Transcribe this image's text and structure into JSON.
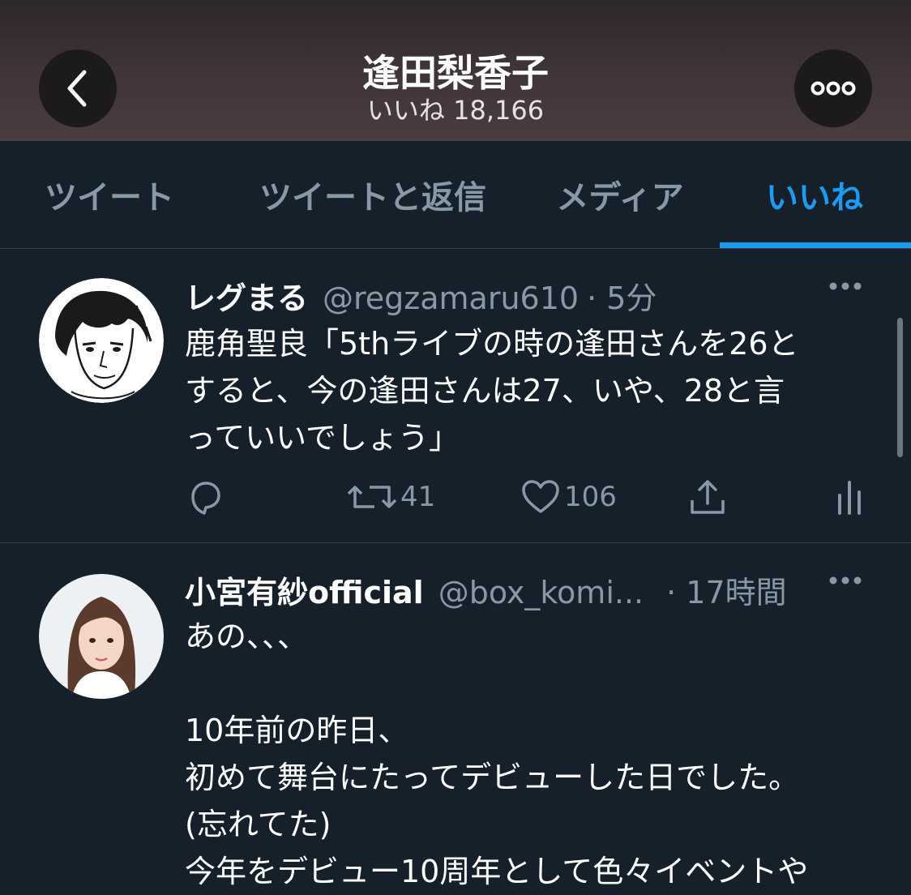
{
  "header": {
    "title": "逢田梨香子",
    "subtitle": "いいね 18,166",
    "back_icon": "chevron-left-icon",
    "more_icon": "more-dots-icon"
  },
  "tabs": [
    {
      "label": "ツイート",
      "active": false
    },
    {
      "label": "ツイートと返信",
      "active": false
    },
    {
      "label": "メディア",
      "active": false
    },
    {
      "label": "いいね",
      "active": true
    }
  ],
  "colors": {
    "background": "#15202b",
    "accent": "#1d9bf0",
    "secondary_text": "#8899a6",
    "divider": "#38444d"
  },
  "tweets": [
    {
      "author": "レグまる",
      "handle": "@regzamaru610",
      "time": "· 5分",
      "text": "鹿角聖良「5thライブの時の逢田さんを26と\nすると、今の逢田さんは27、いや、28と言\nっていいでしょう」",
      "reply_count": "",
      "retweet_count": "41",
      "like_count": "106"
    },
    {
      "author": "小宮有紗official",
      "handle": "@box_komi...",
      "time": "· 17時間",
      "text": "あの、、、\n\n10年前の昨日、\n初めて舞台にたってデビューした日でした。\n(忘れてた)\n今年をデビュー10周年として色々イベントや"
    }
  ]
}
